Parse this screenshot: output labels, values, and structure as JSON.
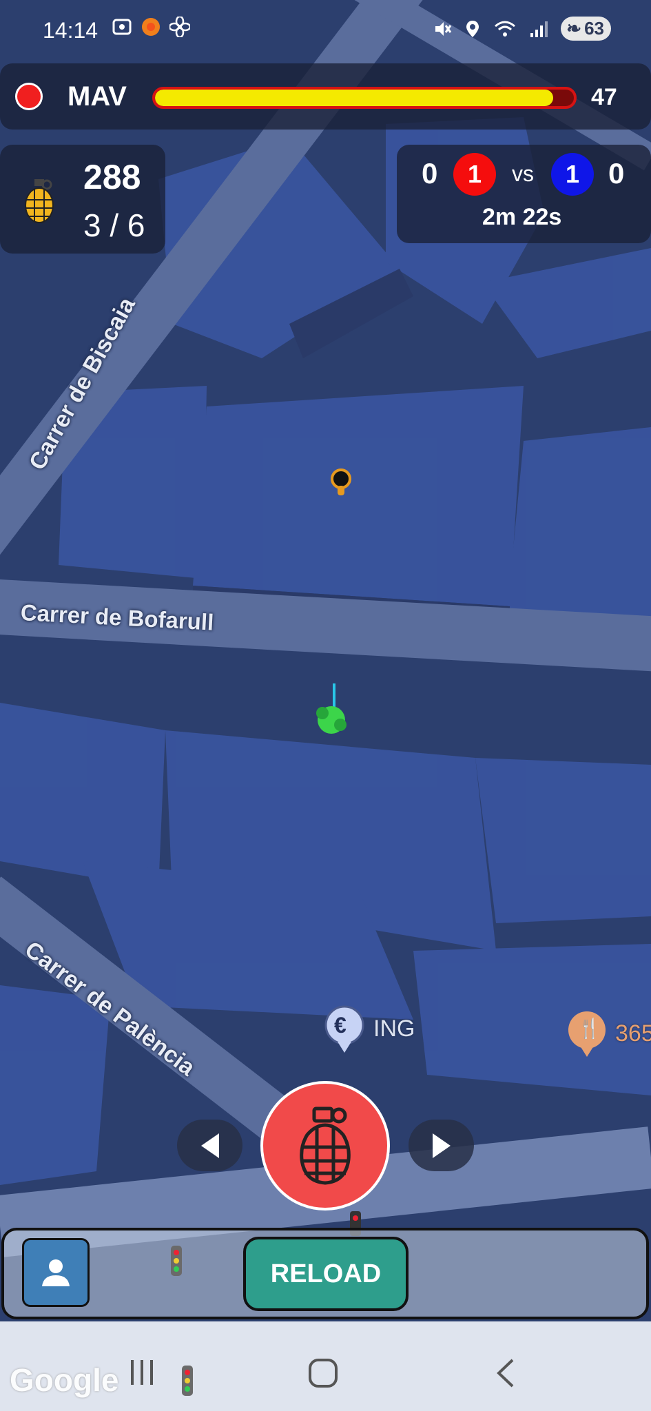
{
  "status_bar": {
    "time": "14:14",
    "battery": "63",
    "icons_left": [
      "screenshot-icon",
      "app-orange-icon",
      "fan-icon"
    ],
    "icons_right": [
      "mute-icon",
      "location-icon",
      "wifi-icon",
      "signal-icon",
      "battery-icon"
    ]
  },
  "player": {
    "name": "MAV",
    "health": 47,
    "health_fraction": 0.95,
    "team_color": "#f01f1f"
  },
  "ammo": {
    "weapon_icon": "grenade-icon",
    "total": "288",
    "clip": "3 / 6"
  },
  "score": {
    "red_kills": "0",
    "red_players": "1",
    "vs": "vs",
    "blue_players": "1",
    "blue_kills": "0",
    "timer": "2m 22s",
    "red_color": "#f50d0d",
    "blue_color": "#0f16e8"
  },
  "map": {
    "streets": [
      "Carrer de Biscaia",
      "Carrer de Bofarull",
      "Carrer de Palència"
    ],
    "pois": [
      {
        "icon": "euro-icon",
        "label": "ING"
      },
      {
        "icon": "restaurant-icon",
        "label": "365"
      }
    ],
    "watermark": "Google"
  },
  "controls": {
    "left_arrow": "previous-weapon",
    "right_arrow": "next-weapon",
    "fire_icon": "grenade-icon",
    "reload_label": "RELOAD"
  },
  "colors": {
    "map_background": "#2f4374",
    "building": "#3a55a0",
    "fire_button": "#f14a4a",
    "reload_button": "#2e9e8c",
    "profile_button": "#3f7fb7"
  }
}
